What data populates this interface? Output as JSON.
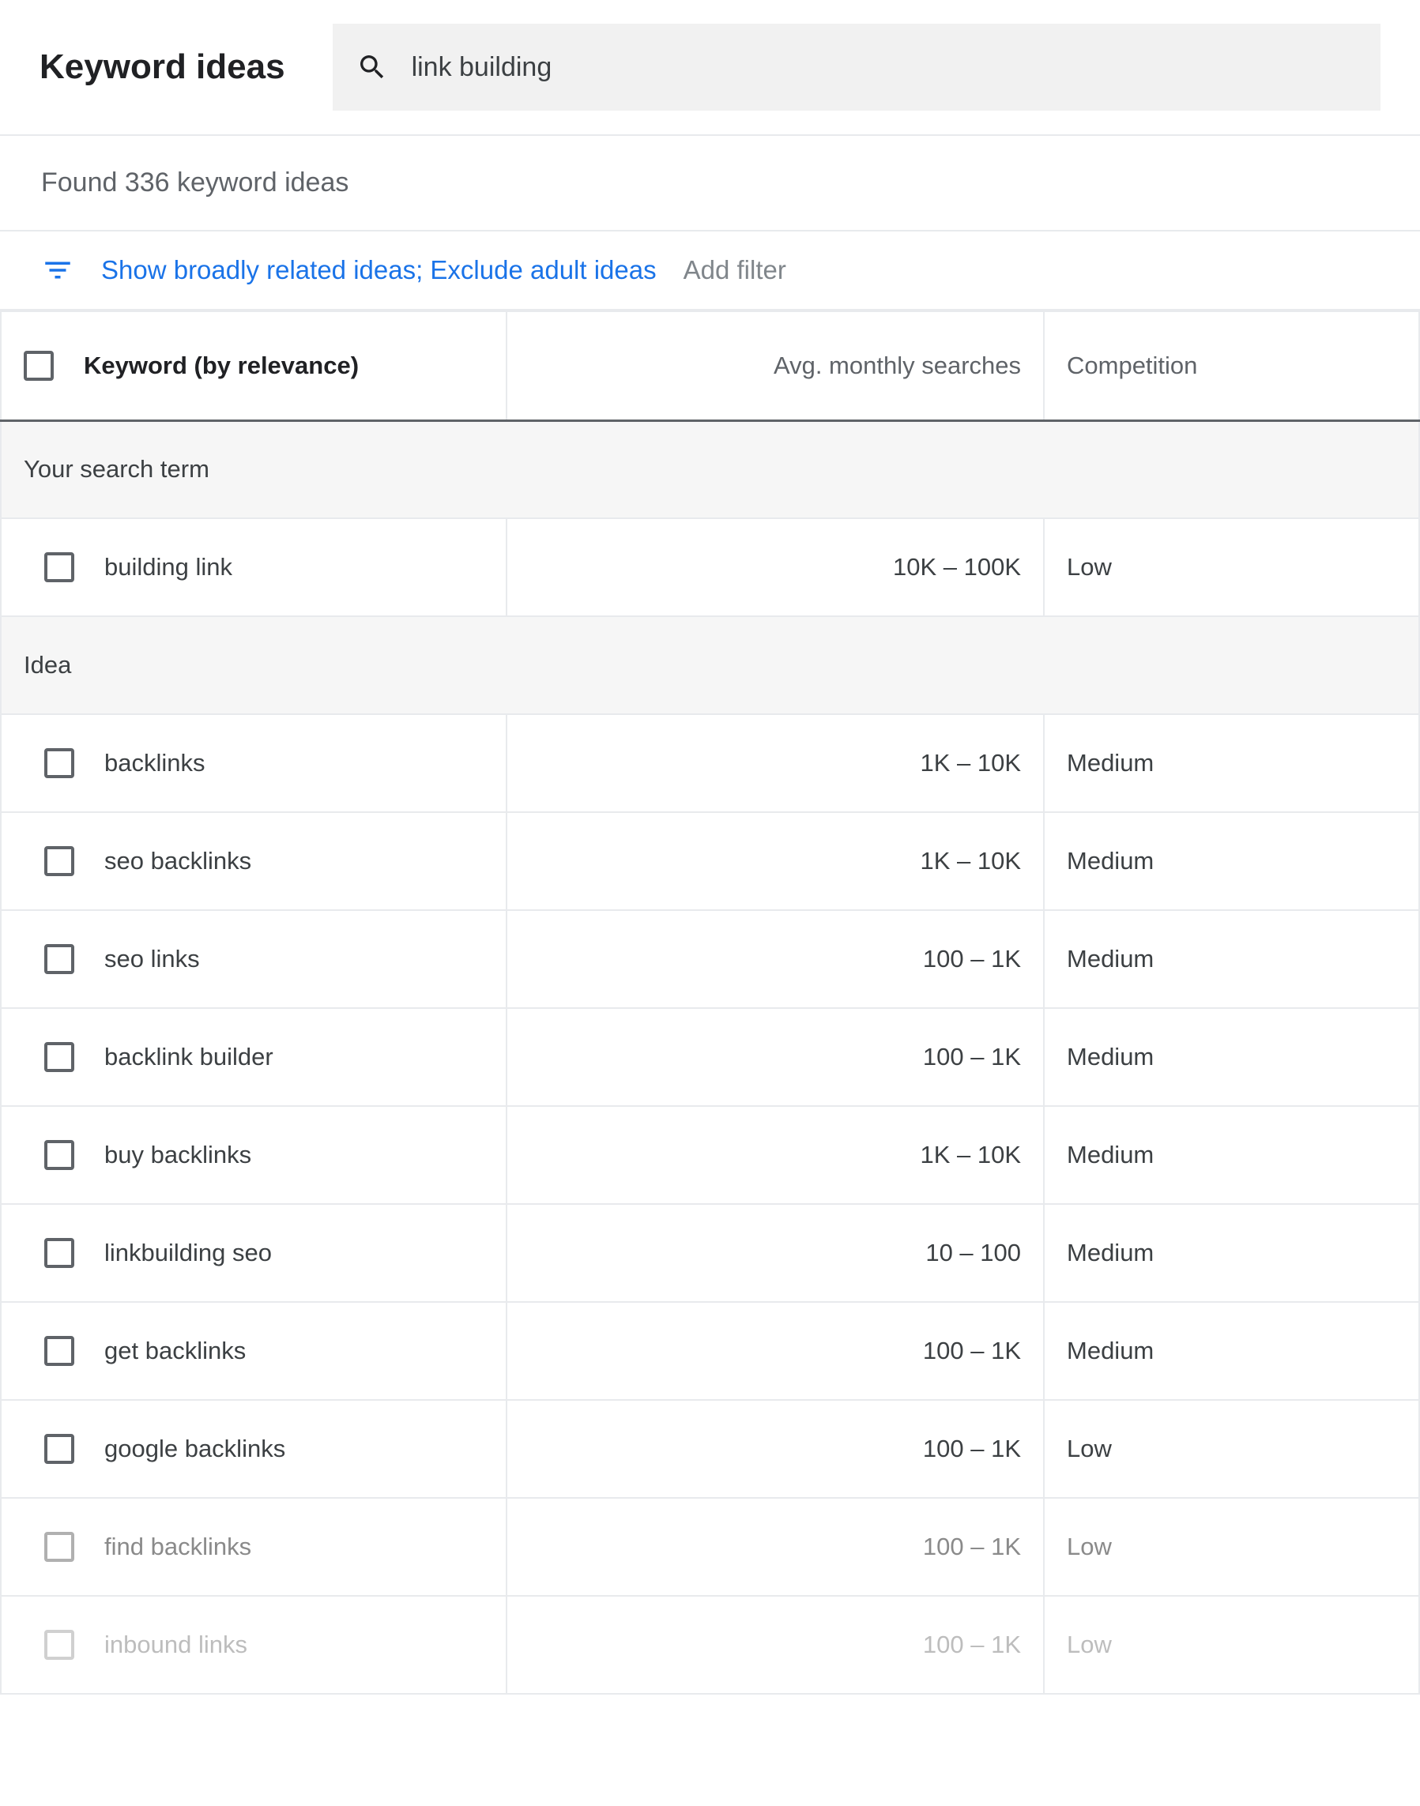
{
  "header": {
    "title": "Keyword ideas",
    "search_value": "link building"
  },
  "found_text": "Found 336 keyword ideas",
  "filter": {
    "link_text": "Show broadly related ideas; Exclude adult ideas",
    "add_filter": "Add filter"
  },
  "columns": {
    "keyword": "Keyword (by relevance)",
    "searches": "Avg. monthly searches",
    "competition": "Competition"
  },
  "sections": {
    "search_term": "Your search term",
    "idea": "Idea"
  },
  "search_rows": [
    {
      "keyword": "building link",
      "searches": "10K – 100K",
      "competition": "Low"
    }
  ],
  "idea_rows": [
    {
      "keyword": "backlinks",
      "searches": "1K – 10K",
      "competition": "Medium"
    },
    {
      "keyword": "seo backlinks",
      "searches": "1K – 10K",
      "competition": "Medium"
    },
    {
      "keyword": "seo links",
      "searches": "100 – 1K",
      "competition": "Medium"
    },
    {
      "keyword": "backlink builder",
      "searches": "100 – 1K",
      "competition": "Medium"
    },
    {
      "keyword": "buy backlinks",
      "searches": "1K – 10K",
      "competition": "Medium"
    },
    {
      "keyword": "linkbuilding seo",
      "searches": "10 – 100",
      "competition": "Medium"
    },
    {
      "keyword": "get backlinks",
      "searches": "100 – 1K",
      "competition": "Medium"
    },
    {
      "keyword": "google backlinks",
      "searches": "100 – 1K",
      "competition": "Low"
    },
    {
      "keyword": "find backlinks",
      "searches": "100 – 1K",
      "competition": "Low"
    },
    {
      "keyword": "inbound links",
      "searches": "100 – 1K",
      "competition": "Low"
    }
  ]
}
